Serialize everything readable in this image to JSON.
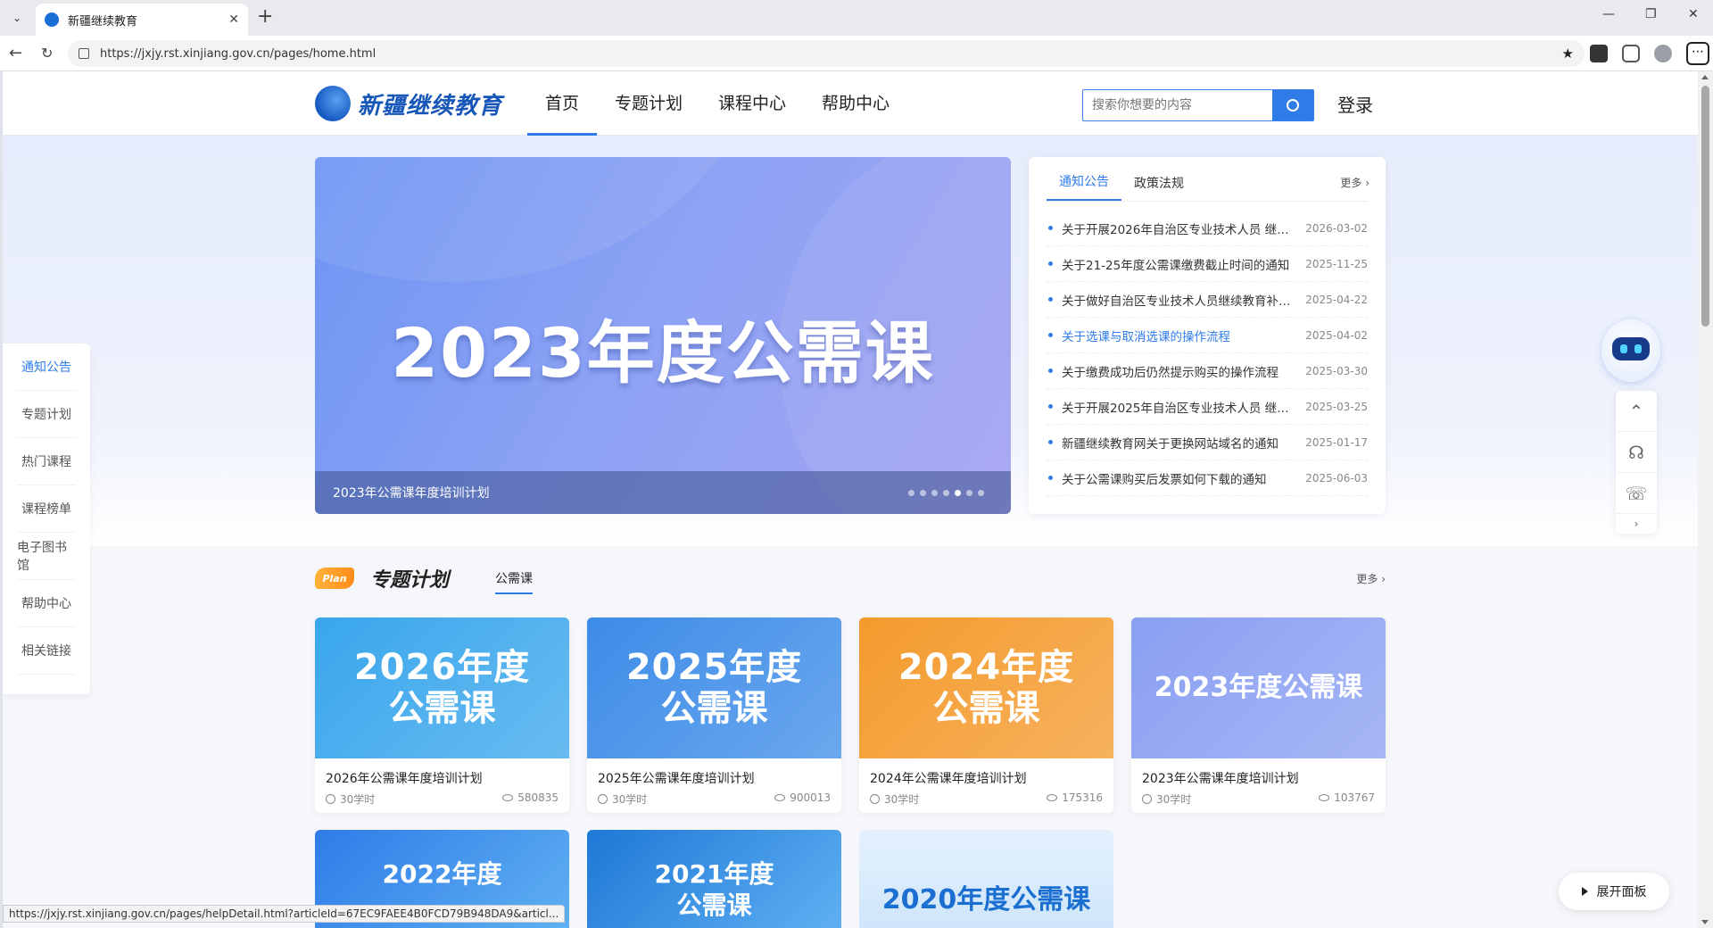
{
  "browser": {
    "tab_title": "新疆继续教育",
    "url": "https://jxjy.rst.xinjiang.gov.cn/pages/home.html",
    "status_url": "https://jxjy.rst.xinjiang.gov.cn/pages/helpDetail.html?articleId=67EC9FAEE4B0FCD79B948DA9&articl..."
  },
  "header": {
    "logo_text": "新疆继续教育",
    "nav": [
      "首页",
      "专题计划",
      "课程中心",
      "帮助中心"
    ],
    "search_placeholder": "搜索你想要的内容",
    "login": "登录"
  },
  "banner": {
    "big_text": "2023年度公需课",
    "caption": "2023年公需课年度培训计划",
    "dots_total": 7,
    "active_dot": 4
  },
  "notice": {
    "tabs": [
      "通知公告",
      "政策法规"
    ],
    "more": "更多",
    "items": [
      {
        "title": "关于开展2026年自治区专业技术人员 继续教育…",
        "date": "2026-03-02"
      },
      {
        "title": "关于21-25年度公需课缴费截止时间的通知",
        "date": "2025-11-25"
      },
      {
        "title": "关于做好自治区专业技术人员继续教育补…",
        "date": "2025-04-22"
      },
      {
        "title": "关于选课与取消选课的操作流程",
        "date": "2025-04-02"
      },
      {
        "title": "关于缴费成功后仍然提示购买的操作流程",
        "date": "2025-03-30"
      },
      {
        "title": "关于开展2025年自治区专业技术人员 继续教育…",
        "date": "2025-03-25"
      },
      {
        "title": "新疆继续教育网关于更换网站域名的通知",
        "date": "2025-01-17"
      },
      {
        "title": "关于公需课购买后发票如何下载的通知",
        "date": "2025-06-03"
      }
    ]
  },
  "leftnav": [
    "通知公告",
    "专题计划",
    "热门课程",
    "课程榜单",
    "电子图书馆",
    "帮助中心",
    "相关链接"
  ],
  "plan_section": {
    "badge": "Plan",
    "title": "专题计划",
    "sub_tab": "公需课",
    "more": "更多"
  },
  "cards": [
    {
      "img_l1": "2026年度",
      "img_l2": "公需课",
      "title": "2026年公需课年度培训计划",
      "hours": "30学时",
      "views": "580835",
      "bg": "#39a6ec"
    },
    {
      "img_l1": "2025年度",
      "img_l2": "公需课",
      "title": "2025年公需课年度培训计划",
      "hours": "30学时",
      "views": "900013",
      "bg": "#3d8ce8"
    },
    {
      "img_l1": "2024年度",
      "img_l2": "公需课",
      "title": "2024年公需课年度培训计划",
      "hours": "30学时",
      "views": "175316",
      "bg": "#f49a2c"
    },
    {
      "img_one": "2023年度公需课",
      "title": "2023年公需课年度培训计划",
      "hours": "30学时",
      "views": "103767",
      "bg": "#8a9ff2"
    }
  ],
  "cards_bottom": [
    {
      "text": "2022年度",
      "bg": "#2f7ce8"
    },
    {
      "text": "2021年度",
      "sub": "公需课",
      "bg": "#1e78d6"
    },
    {
      "text": "2020年度公需课",
      "bg": "#cfe6fa"
    }
  ],
  "expand_panel": "展开面板"
}
